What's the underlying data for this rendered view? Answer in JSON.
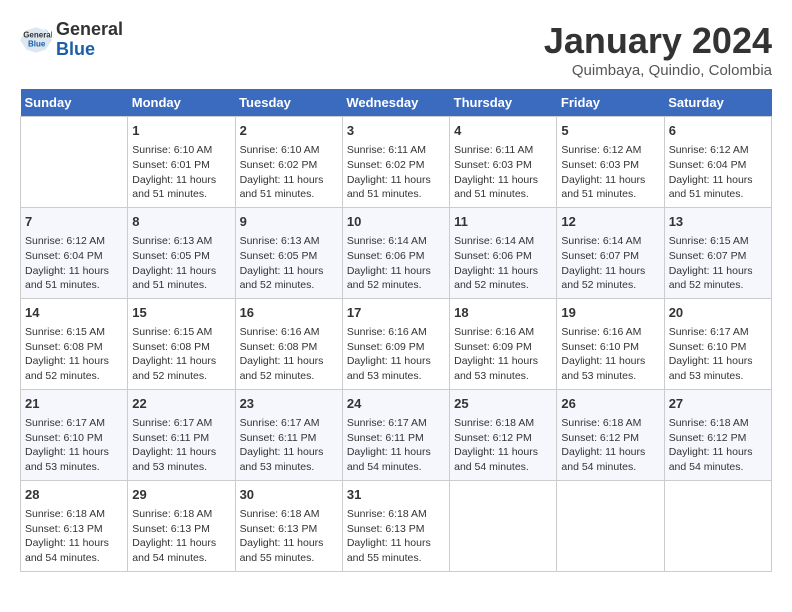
{
  "header": {
    "logo_general": "General",
    "logo_blue": "Blue",
    "month": "January 2024",
    "location": "Quimbaya, Quindio, Colombia"
  },
  "weekdays": [
    "Sunday",
    "Monday",
    "Tuesday",
    "Wednesday",
    "Thursday",
    "Friday",
    "Saturday"
  ],
  "weeks": [
    [
      {
        "day": "",
        "sunrise": "",
        "sunset": "",
        "daylight": ""
      },
      {
        "day": "1",
        "sunrise": "Sunrise: 6:10 AM",
        "sunset": "Sunset: 6:01 PM",
        "daylight": "Daylight: 11 hours and 51 minutes."
      },
      {
        "day": "2",
        "sunrise": "Sunrise: 6:10 AM",
        "sunset": "Sunset: 6:02 PM",
        "daylight": "Daylight: 11 hours and 51 minutes."
      },
      {
        "day": "3",
        "sunrise": "Sunrise: 6:11 AM",
        "sunset": "Sunset: 6:02 PM",
        "daylight": "Daylight: 11 hours and 51 minutes."
      },
      {
        "day": "4",
        "sunrise": "Sunrise: 6:11 AM",
        "sunset": "Sunset: 6:03 PM",
        "daylight": "Daylight: 11 hours and 51 minutes."
      },
      {
        "day": "5",
        "sunrise": "Sunrise: 6:12 AM",
        "sunset": "Sunset: 6:03 PM",
        "daylight": "Daylight: 11 hours and 51 minutes."
      },
      {
        "day": "6",
        "sunrise": "Sunrise: 6:12 AM",
        "sunset": "Sunset: 6:04 PM",
        "daylight": "Daylight: 11 hours and 51 minutes."
      }
    ],
    [
      {
        "day": "7",
        "sunrise": "Sunrise: 6:12 AM",
        "sunset": "Sunset: 6:04 PM",
        "daylight": "Daylight: 11 hours and 51 minutes."
      },
      {
        "day": "8",
        "sunrise": "Sunrise: 6:13 AM",
        "sunset": "Sunset: 6:05 PM",
        "daylight": "Daylight: 11 hours and 51 minutes."
      },
      {
        "day": "9",
        "sunrise": "Sunrise: 6:13 AM",
        "sunset": "Sunset: 6:05 PM",
        "daylight": "Daylight: 11 hours and 52 minutes."
      },
      {
        "day": "10",
        "sunrise": "Sunrise: 6:14 AM",
        "sunset": "Sunset: 6:06 PM",
        "daylight": "Daylight: 11 hours and 52 minutes."
      },
      {
        "day": "11",
        "sunrise": "Sunrise: 6:14 AM",
        "sunset": "Sunset: 6:06 PM",
        "daylight": "Daylight: 11 hours and 52 minutes."
      },
      {
        "day": "12",
        "sunrise": "Sunrise: 6:14 AM",
        "sunset": "Sunset: 6:07 PM",
        "daylight": "Daylight: 11 hours and 52 minutes."
      },
      {
        "day": "13",
        "sunrise": "Sunrise: 6:15 AM",
        "sunset": "Sunset: 6:07 PM",
        "daylight": "Daylight: 11 hours and 52 minutes."
      }
    ],
    [
      {
        "day": "14",
        "sunrise": "Sunrise: 6:15 AM",
        "sunset": "Sunset: 6:08 PM",
        "daylight": "Daylight: 11 hours and 52 minutes."
      },
      {
        "day": "15",
        "sunrise": "Sunrise: 6:15 AM",
        "sunset": "Sunset: 6:08 PM",
        "daylight": "Daylight: 11 hours and 52 minutes."
      },
      {
        "day": "16",
        "sunrise": "Sunrise: 6:16 AM",
        "sunset": "Sunset: 6:08 PM",
        "daylight": "Daylight: 11 hours and 52 minutes."
      },
      {
        "day": "17",
        "sunrise": "Sunrise: 6:16 AM",
        "sunset": "Sunset: 6:09 PM",
        "daylight": "Daylight: 11 hours and 53 minutes."
      },
      {
        "day": "18",
        "sunrise": "Sunrise: 6:16 AM",
        "sunset": "Sunset: 6:09 PM",
        "daylight": "Daylight: 11 hours and 53 minutes."
      },
      {
        "day": "19",
        "sunrise": "Sunrise: 6:16 AM",
        "sunset": "Sunset: 6:10 PM",
        "daylight": "Daylight: 11 hours and 53 minutes."
      },
      {
        "day": "20",
        "sunrise": "Sunrise: 6:17 AM",
        "sunset": "Sunset: 6:10 PM",
        "daylight": "Daylight: 11 hours and 53 minutes."
      }
    ],
    [
      {
        "day": "21",
        "sunrise": "Sunrise: 6:17 AM",
        "sunset": "Sunset: 6:10 PM",
        "daylight": "Daylight: 11 hours and 53 minutes."
      },
      {
        "day": "22",
        "sunrise": "Sunrise: 6:17 AM",
        "sunset": "Sunset: 6:11 PM",
        "daylight": "Daylight: 11 hours and 53 minutes."
      },
      {
        "day": "23",
        "sunrise": "Sunrise: 6:17 AM",
        "sunset": "Sunset: 6:11 PM",
        "daylight": "Daylight: 11 hours and 53 minutes."
      },
      {
        "day": "24",
        "sunrise": "Sunrise: 6:17 AM",
        "sunset": "Sunset: 6:11 PM",
        "daylight": "Daylight: 11 hours and 54 minutes."
      },
      {
        "day": "25",
        "sunrise": "Sunrise: 6:18 AM",
        "sunset": "Sunset: 6:12 PM",
        "daylight": "Daylight: 11 hours and 54 minutes."
      },
      {
        "day": "26",
        "sunrise": "Sunrise: 6:18 AM",
        "sunset": "Sunset: 6:12 PM",
        "daylight": "Daylight: 11 hours and 54 minutes."
      },
      {
        "day": "27",
        "sunrise": "Sunrise: 6:18 AM",
        "sunset": "Sunset: 6:12 PM",
        "daylight": "Daylight: 11 hours and 54 minutes."
      }
    ],
    [
      {
        "day": "28",
        "sunrise": "Sunrise: 6:18 AM",
        "sunset": "Sunset: 6:13 PM",
        "daylight": "Daylight: 11 hours and 54 minutes."
      },
      {
        "day": "29",
        "sunrise": "Sunrise: 6:18 AM",
        "sunset": "Sunset: 6:13 PM",
        "daylight": "Daylight: 11 hours and 54 minutes."
      },
      {
        "day": "30",
        "sunrise": "Sunrise: 6:18 AM",
        "sunset": "Sunset: 6:13 PM",
        "daylight": "Daylight: 11 hours and 55 minutes."
      },
      {
        "day": "31",
        "sunrise": "Sunrise: 6:18 AM",
        "sunset": "Sunset: 6:13 PM",
        "daylight": "Daylight: 11 hours and 55 minutes."
      },
      {
        "day": "",
        "sunrise": "",
        "sunset": "",
        "daylight": ""
      },
      {
        "day": "",
        "sunrise": "",
        "sunset": "",
        "daylight": ""
      },
      {
        "day": "",
        "sunrise": "",
        "sunset": "",
        "daylight": ""
      }
    ]
  ]
}
